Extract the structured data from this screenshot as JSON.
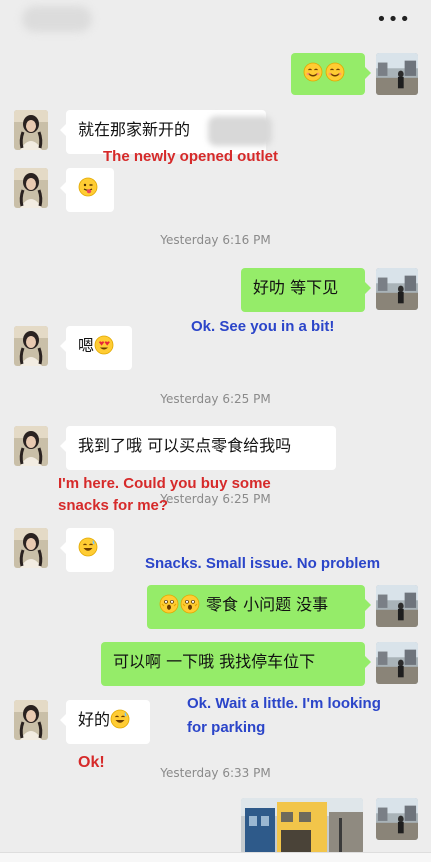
{
  "header": {
    "title_icon": "blurred-contact-name",
    "more_icon": "more-dots-icon"
  },
  "messages": [
    {
      "side": "out",
      "text": "",
      "emojis": [
        "smile-emoji",
        "smile-emoji"
      ]
    },
    {
      "side": "in",
      "text": "就在那家新开的",
      "translation": "The newly opened outlet"
    },
    {
      "side": "in",
      "text": "",
      "emojis": [
        "tongue-emoji"
      ]
    },
    {
      "timestamp": "Yesterday 6:16 PM"
    },
    {
      "side": "out",
      "text": "好叻 等下见",
      "translation": "Ok. See you in a bit!"
    },
    {
      "side": "in",
      "text": "嗯",
      "emojis": [
        "heart-eyes-emoji"
      ]
    },
    {
      "timestamp": "Yesterday 6:25 PM"
    },
    {
      "side": "in",
      "text": "我到了哦 可以买点零食给我吗",
      "translation_line1": "I'm here. Could you buy some",
      "translation_line2": "snacks for me?"
    },
    {
      "timestamp": "Yesterday 6:25 PM"
    },
    {
      "side": "in",
      "text": "",
      "emojis": [
        "sweat-smile-emoji"
      ]
    },
    {
      "side": "out",
      "text": "零食 小问题 没事",
      "emojis": [
        "shock-emoji",
        "shock-emoji"
      ],
      "translation": "Snacks. Small issue. No problem"
    },
    {
      "side": "out",
      "text": "可以啊 一下哦 我找停车位下",
      "translation_line1": "Ok. Wait a little. I'm looking",
      "translation_line2": "for parking"
    },
    {
      "side": "in",
      "text": "好的",
      "emojis": [
        "sweat-smile-emoji"
      ],
      "translation": "Ok!"
    },
    {
      "timestamp": "Yesterday 6:33 PM"
    },
    {
      "side": "out",
      "image": "street-photo"
    }
  ],
  "colors": {
    "out_bubble": "#95ec69",
    "in_bubble": "#ffffff",
    "background": "#ededed",
    "translation_in": "#d62a2a",
    "translation_out": "#2b45c9"
  }
}
